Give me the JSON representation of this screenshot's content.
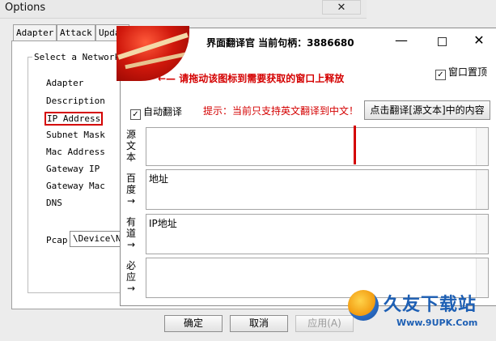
{
  "options_window": {
    "title": "Options",
    "close_glyph": "✕",
    "tabs": [
      "Adapter",
      "Attack",
      "Upda"
    ],
    "group_title": "Select a Network I",
    "fields": [
      "Adapter",
      "Description",
      "IP Address",
      "Subnet Mask",
      "Mac Address",
      "Gateway IP",
      "Gateway Mac",
      "DNS"
    ],
    "pcap_label": "Pcap",
    "pcap_value": "\\Device\\NP",
    "buttons": {
      "ok": "确定",
      "cancel": "取消",
      "apply": "应用(A)"
    }
  },
  "translator_window": {
    "title": "界面翻译官  当前句柄：3886680",
    "min_glyph": "—",
    "close_glyph": "✕",
    "drag_hint": "←— 请拖动该图标到需要获取的窗口上释放",
    "always_on_top": {
      "label": "窗口置顶",
      "checked": true
    },
    "auto_translate": {
      "label": "自动翻译",
      "checked": true
    },
    "tip": "提示：当前只支持英文翻译到中文！",
    "translate_button": "点击翻译[源文本]中的内容",
    "rows": [
      {
        "label": "源文本",
        "content": ""
      },
      {
        "label": "百度→",
        "content": "地址"
      },
      {
        "label": "有道→",
        "content": "IP地址"
      },
      {
        "label": "必应→",
        "content": ""
      }
    ],
    "accent_color": "#d40000"
  },
  "watermark": {
    "name": "久友下载站",
    "url": "Www.9UPK.Com"
  }
}
